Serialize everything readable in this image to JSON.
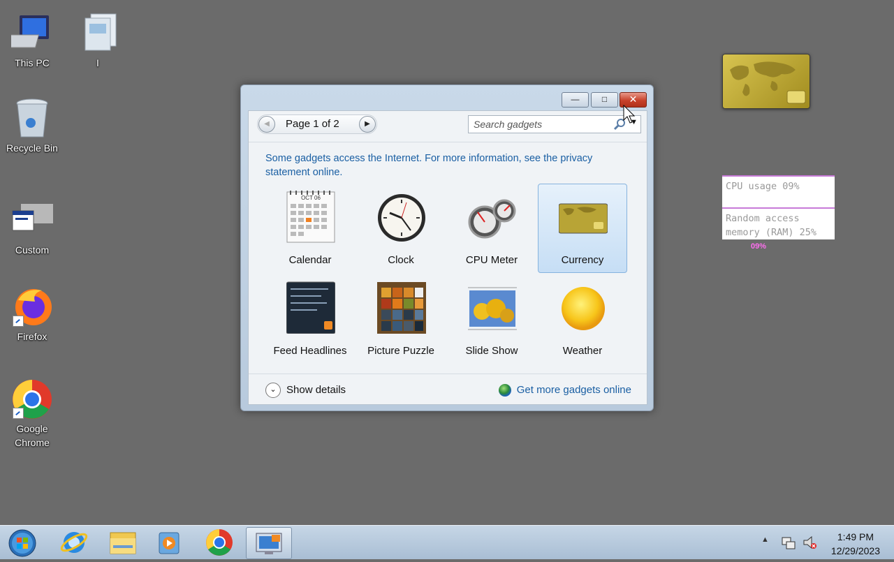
{
  "desktop": {
    "icons": [
      {
        "label": "This PC",
        "icon": "computer-icon"
      },
      {
        "label": "I",
        "icon": "library-icon"
      },
      {
        "label": "Recycle Bin",
        "icon": "recycle-bin-icon"
      },
      {
        "label": "Custom",
        "icon": "custom-window-icon"
      },
      {
        "label": "Firefox",
        "icon": "firefox-icon"
      },
      {
        "label": "Google Chrome",
        "icon": "chrome-icon"
      }
    ]
  },
  "gadgets_window": {
    "pager": {
      "text": "Page 1 of 2",
      "current_page": 1,
      "total_pages": 2
    },
    "search": {
      "placeholder": "Search gadgets",
      "value": ""
    },
    "notice": "Some gadgets access the Internet.  For more information, see the privacy statement online.",
    "gadgets": [
      {
        "label": "Calendar",
        "icon": "calendar-icon",
        "month": "OCT 06",
        "selected": false
      },
      {
        "label": "Clock",
        "icon": "clock-icon",
        "selected": false
      },
      {
        "label": "CPU Meter",
        "icon": "cpu-meter-icon",
        "selected": false
      },
      {
        "label": "Currency",
        "icon": "currency-icon",
        "selected": true
      },
      {
        "label": "Feed Headlines",
        "icon": "feed-headlines-icon",
        "selected": false
      },
      {
        "label": "Picture Puzzle",
        "icon": "picture-puzzle-icon",
        "selected": false
      },
      {
        "label": "Slide Show",
        "icon": "slide-show-icon",
        "selected": false
      },
      {
        "label": "Weather",
        "icon": "weather-icon",
        "selected": false
      }
    ],
    "show_details": "Show details",
    "get_more": "Get more gadgets online"
  },
  "desktop_gadgets": {
    "cpu_usage": "CPU usage 09%",
    "ram_usage": "Random access memory (RAM) 25%",
    "pct_label": "09%"
  },
  "taskbar": {
    "items": [
      "start-orb-icon",
      "internet-explorer-icon",
      "file-explorer-icon",
      "media-player-icon",
      "chrome-icon",
      "gadgets-icon"
    ],
    "time": "1:49 PM",
    "date": "12/29/2023"
  },
  "colors": {
    "desktop": "#6b6b6b",
    "link": "#1a5fa3",
    "close": "#c7412a",
    "accent": "#c77ad8"
  }
}
